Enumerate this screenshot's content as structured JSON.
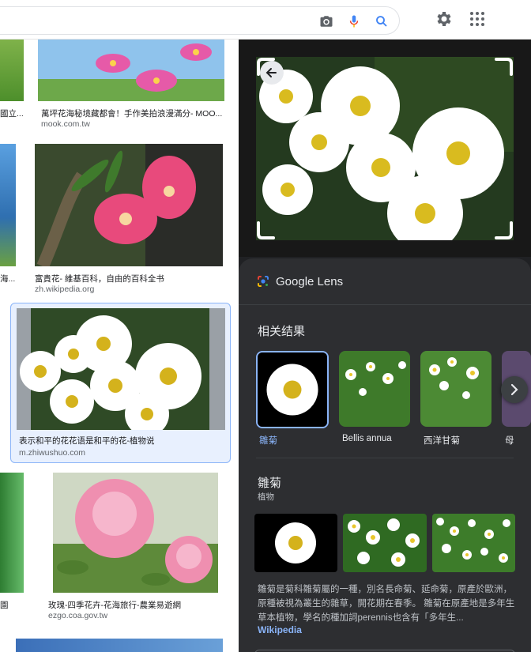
{
  "left_results": [
    {
      "caption": "萬坪花海秘境藏都會！手作美拍浪漫滿分- MOO...",
      "source": "mook.com.tw"
    },
    {
      "caption": "富貴花- 維基百科，自由的百科全书",
      "source": "zh.wikipedia.org"
    },
    {
      "caption": "表示和平的花花语是和平的花-植物说",
      "source": "m.zhiwushuo.com"
    },
    {
      "caption": "玫瑰-四季花卉-花海旅行-農業易遊網",
      "source": "ezgo.coa.gov.tw"
    }
  ],
  "left_partial": {
    "c1": "國立...",
    "c2": "海...",
    "c3": "園"
  },
  "lens": {
    "title": "Google Lens",
    "related_title": "相关结果",
    "related": [
      {
        "label": "雛菊"
      },
      {
        "label": "Bellis annua"
      },
      {
        "label": "西洋甘菊"
      },
      {
        "label": "母"
      }
    ],
    "entity": {
      "title": "雛菊",
      "subtitle": "植物",
      "description": "雛菊是菊科雛菊屬的一種，別名長命菊、延命菊，原產於歐洲，原種被視為叢生的雜草，開花期在春季。 雛菊在原產地是多年生草本植物，學名的種加詞perennis也含有「多年生...",
      "source_link": "Wikipedia"
    }
  },
  "colors": {
    "accent": "#8ab4f8",
    "panel": "#2d2e31",
    "dark": "#202124"
  }
}
